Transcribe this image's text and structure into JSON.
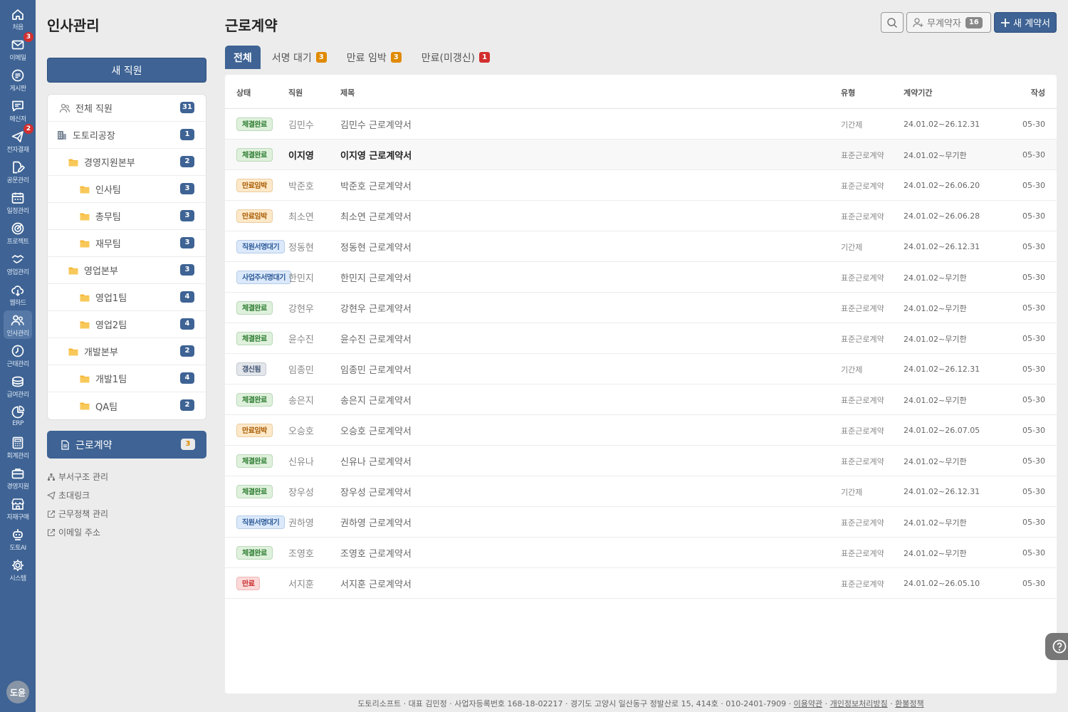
{
  "rail": {
    "items": [
      {
        "label": "처음",
        "icon": "home-icon"
      },
      {
        "label": "이메일",
        "icon": "mail-icon",
        "badge": "3"
      },
      {
        "label": "게시판",
        "icon": "board-icon"
      },
      {
        "label": "메신저",
        "icon": "messenger-icon"
      },
      {
        "label": "전자결재",
        "icon": "approval-icon",
        "badge": "2"
      },
      {
        "label": "공문관리",
        "icon": "document-edit-icon"
      },
      {
        "label": "일정관리",
        "icon": "calendar-icon"
      },
      {
        "label": "프로젝트",
        "icon": "target-icon"
      },
      {
        "label": "영업관리",
        "icon": "handshake-icon"
      },
      {
        "label": "웹하드",
        "icon": "cloud-icon"
      },
      {
        "label": "인사관리",
        "icon": "people-icon",
        "active": true
      },
      {
        "label": "근태관리",
        "icon": "clock-icon"
      },
      {
        "label": "급여관리",
        "icon": "coins-icon"
      },
      {
        "label": "ERP",
        "icon": "pie-chart-icon"
      },
      {
        "label": "회계관리",
        "icon": "calculator-icon"
      },
      {
        "label": "경영지원",
        "icon": "briefcase-icon"
      },
      {
        "label": "자재구매",
        "icon": "store-icon"
      },
      {
        "label": "도토AI",
        "icon": "robot-icon"
      },
      {
        "label": "시스템",
        "icon": "gear-icon"
      }
    ],
    "avatar": "도윤"
  },
  "sidebar": {
    "title": "인사관리",
    "new_employee": "새 직원",
    "tree": [
      {
        "label": "전체 직원",
        "count": "31",
        "kind": "people",
        "level": 0
      },
      {
        "label": "도토리공장",
        "count": "1",
        "kind": "building",
        "level": 0
      },
      {
        "label": "경영지원본부",
        "count": "2",
        "kind": "folder",
        "level": 1
      },
      {
        "label": "인사팀",
        "count": "3",
        "kind": "folder",
        "level": 2
      },
      {
        "label": "총무팀",
        "count": "3",
        "kind": "folder",
        "level": 2
      },
      {
        "label": "재무팀",
        "count": "3",
        "kind": "folder",
        "level": 2
      },
      {
        "label": "영업본부",
        "count": "3",
        "kind": "folder",
        "level": 1
      },
      {
        "label": "영업1팀",
        "count": "4",
        "kind": "folder",
        "level": 2
      },
      {
        "label": "영업2팀",
        "count": "4",
        "kind": "folder",
        "level": 2
      },
      {
        "label": "개발본부",
        "count": "2",
        "kind": "folder",
        "level": 1
      },
      {
        "label": "개발1팀",
        "count": "4",
        "kind": "folder",
        "level": 2
      },
      {
        "label": "QA팀",
        "count": "2",
        "kind": "folder",
        "level": 2
      }
    ],
    "contract": {
      "label": "근로계약",
      "badge": "3"
    },
    "links": [
      {
        "label": "부서구조 관리",
        "icon": "org-chart-icon"
      },
      {
        "label": "초대링크",
        "icon": "send-icon"
      },
      {
        "label": "근무정책 관리",
        "icon": "external-link-icon"
      },
      {
        "label": "이메일 주소",
        "icon": "external-link-icon"
      }
    ]
  },
  "main": {
    "title": "근로계약",
    "unsigned_label": "무계약자",
    "unsigned_count": "16",
    "new_contract": "새 계약서",
    "tabs": [
      {
        "label": "전체",
        "active": true
      },
      {
        "label": "서명 대기",
        "badge": "3",
        "badge_color": "#e08a00"
      },
      {
        "label": "만료 임박",
        "badge": "3",
        "badge_color": "#e08a00"
      },
      {
        "label": "만료(미갱신)",
        "badge": "1",
        "badge_color": "#d32f2f"
      }
    ],
    "columns": {
      "status": "상태",
      "employee": "직원",
      "title": "제목",
      "type": "유형",
      "period": "계약기간",
      "created": "작성"
    },
    "rows": [
      {
        "status": "체결완료",
        "tone": "green",
        "employee": "김민수",
        "title": "김민수 근로계약서",
        "type": "기간제",
        "period": "24.01.02~26.12.31",
        "created": "05-30"
      },
      {
        "status": "체결완료",
        "tone": "green",
        "employee": "이지영",
        "title": "이지영 근로계약서",
        "type": "표준근로계약",
        "period": "24.01.02~무기한",
        "created": "05-30",
        "bold": true
      },
      {
        "status": "만료임박",
        "tone": "orange",
        "employee": "박준호",
        "title": "박준호 근로계약서",
        "type": "표준근로계약",
        "period": "24.01.02~26.06.20",
        "created": "05-30"
      },
      {
        "status": "만료임박",
        "tone": "orange",
        "employee": "최소연",
        "title": "최소연 근로계약서",
        "type": "표준근로계약",
        "period": "24.01.02~26.06.28",
        "created": "05-30"
      },
      {
        "status": "직원서명대기",
        "tone": "blue",
        "employee": "정동현",
        "title": "정동현 근로계약서",
        "type": "기간제",
        "period": "24.01.02~26.12.31",
        "created": "05-30"
      },
      {
        "status": "사업주서명대기",
        "tone": "blue",
        "employee": "한민지",
        "title": "한민지 근로계약서",
        "type": "표준근로계약",
        "period": "24.01.02~무기한",
        "created": "05-30"
      },
      {
        "status": "체결완료",
        "tone": "green",
        "employee": "강현우",
        "title": "강현우 근로계약서",
        "type": "표준근로계약",
        "period": "24.01.02~무기한",
        "created": "05-30"
      },
      {
        "status": "체결완료",
        "tone": "green",
        "employee": "윤수진",
        "title": "윤수진 근로계약서",
        "type": "표준근로계약",
        "period": "24.01.02~무기한",
        "created": "05-30"
      },
      {
        "status": "갱신됨",
        "tone": "gray",
        "employee": "임종민",
        "title": "임종민 근로계약서",
        "type": "기간제",
        "period": "24.01.02~26.12.31",
        "created": "05-30"
      },
      {
        "status": "체결완료",
        "tone": "green",
        "employee": "송은지",
        "title": "송은지 근로계약서",
        "type": "표준근로계약",
        "period": "24.01.02~무기한",
        "created": "05-30"
      },
      {
        "status": "만료임박",
        "tone": "orange",
        "employee": "오승호",
        "title": "오승호 근로계약서",
        "type": "표준근로계약",
        "period": "24.01.02~26.07.05",
        "created": "05-30"
      },
      {
        "status": "체결완료",
        "tone": "green",
        "employee": "신유나",
        "title": "신유나 근로계약서",
        "type": "표준근로계약",
        "period": "24.01.02~무기한",
        "created": "05-30"
      },
      {
        "status": "체결완료",
        "tone": "green",
        "employee": "장우성",
        "title": "장우성 근로계약서",
        "type": "기간제",
        "period": "24.01.02~26.12.31",
        "created": "05-30"
      },
      {
        "status": "직원서명대기",
        "tone": "blue",
        "employee": "권하영",
        "title": "권하영 근로계약서",
        "type": "표준근로계약",
        "period": "24.01.02~무기한",
        "created": "05-30"
      },
      {
        "status": "체결완료",
        "tone": "green",
        "employee": "조영호",
        "title": "조영호 근로계약서",
        "type": "표준근로계약",
        "period": "24.01.02~무기한",
        "created": "05-30"
      },
      {
        "status": "만료",
        "tone": "red",
        "employee": "서지훈",
        "title": "서지훈 근로계약서",
        "type": "표준근로계약",
        "period": "24.01.02~26.05.10",
        "created": "05-30"
      }
    ]
  },
  "footer": {
    "text": "도토리소프트 · 대표 김민정 · 사업자등록번호 168-18-02217 · 경기도 고양시 일산동구 정발산로 15, 414호 · 010-2401-7909 · ",
    "links": [
      "이용약관",
      "개인정보처리방침",
      "환불정책"
    ]
  },
  "colors": {
    "brand": "#3e6394",
    "green_bg": "#dff1dc",
    "green_fg": "#2e7d32",
    "orange_bg": "#fde9c9",
    "orange_fg": "#a75a00",
    "blue_bg": "#dbe9fb",
    "blue_fg": "#2f5c99",
    "gray_bg": "#e3e6ea",
    "gray_fg": "#3e5474",
    "red_bg": "#fbd9d9",
    "red_fg": "#c62828"
  }
}
